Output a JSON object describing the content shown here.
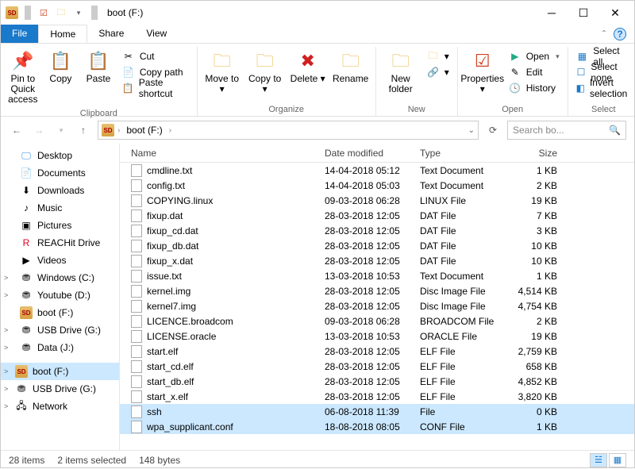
{
  "title": "boot (F:)",
  "tabs": {
    "file": "File",
    "home": "Home",
    "share": "Share",
    "view": "View"
  },
  "ribbon": {
    "clipboard": {
      "label": "Clipboard",
      "pin": "Pin to Quick access",
      "copy": "Copy",
      "paste": "Paste",
      "cut": "Cut",
      "copypath": "Copy path",
      "pasteshortcut": "Paste shortcut"
    },
    "organize": {
      "label": "Organize",
      "moveto": "Move to",
      "copyto": "Copy to",
      "delete": "Delete",
      "rename": "Rename"
    },
    "new": {
      "label": "New",
      "newfolder": "New folder",
      "newitem": "",
      "easyaccess": ""
    },
    "open": {
      "label": "Open",
      "properties": "Properties",
      "open": "Open",
      "edit": "Edit",
      "history": "History"
    },
    "select": {
      "label": "Select",
      "selectall": "Select all",
      "selectnone": "Select none",
      "invert": "Invert selection"
    }
  },
  "address": {
    "crumb1": "boot (F:)",
    "refresh": "⟳",
    "search_placeholder": "Search bo..."
  },
  "nav": [
    {
      "label": "Desktop",
      "ico": "🖵",
      "color": "#3a8ee6"
    },
    {
      "label": "Documents",
      "ico": "📄"
    },
    {
      "label": "Downloads",
      "ico": "⬇"
    },
    {
      "label": "Music",
      "ico": "♪"
    },
    {
      "label": "Pictures",
      "ico": "▣"
    },
    {
      "label": "REACHit Drive",
      "ico": "R",
      "color": "#d02"
    },
    {
      "label": "Videos",
      "ico": "▶"
    },
    {
      "label": "Windows (C:)",
      "ico": "⛃",
      "exp": ">"
    },
    {
      "label": "Youtube (D:)",
      "ico": "⛃",
      "exp": ">"
    },
    {
      "label": "boot (F:)",
      "ico": "SD"
    },
    {
      "label": "USB Drive (G:)",
      "ico": "⛃",
      "exp": ">"
    },
    {
      "label": "Data (J:)",
      "ico": "⛃",
      "exp": ">"
    }
  ],
  "nav2": [
    {
      "label": "boot (F:)",
      "ico": "SD",
      "exp": ">",
      "selected": true
    },
    {
      "label": "USB Drive (G:)",
      "ico": "⛃",
      "exp": ">"
    },
    {
      "label": "Network",
      "ico": "🖧",
      "exp": ">"
    }
  ],
  "cols": {
    "name": "Name",
    "date": "Date modified",
    "type": "Type",
    "size": "Size"
  },
  "files": [
    {
      "name": "cmdline.txt",
      "date": "14-04-2018 05:12",
      "type": "Text Document",
      "size": "1 KB"
    },
    {
      "name": "config.txt",
      "date": "14-04-2018 05:03",
      "type": "Text Document",
      "size": "2 KB"
    },
    {
      "name": "COPYING.linux",
      "date": "09-03-2018 06:28",
      "type": "LINUX File",
      "size": "19 KB"
    },
    {
      "name": "fixup.dat",
      "date": "28-03-2018 12:05",
      "type": "DAT File",
      "size": "7 KB"
    },
    {
      "name": "fixup_cd.dat",
      "date": "28-03-2018 12:05",
      "type": "DAT File",
      "size": "3 KB"
    },
    {
      "name": "fixup_db.dat",
      "date": "28-03-2018 12:05",
      "type": "DAT File",
      "size": "10 KB"
    },
    {
      "name": "fixup_x.dat",
      "date": "28-03-2018 12:05",
      "type": "DAT File",
      "size": "10 KB"
    },
    {
      "name": "issue.txt",
      "date": "13-03-2018 10:53",
      "type": "Text Document",
      "size": "1 KB"
    },
    {
      "name": "kernel.img",
      "date": "28-03-2018 12:05",
      "type": "Disc Image File",
      "size": "4,514 KB"
    },
    {
      "name": "kernel7.img",
      "date": "28-03-2018 12:05",
      "type": "Disc Image File",
      "size": "4,754 KB"
    },
    {
      "name": "LICENCE.broadcom",
      "date": "09-03-2018 06:28",
      "type": "BROADCOM File",
      "size": "2 KB"
    },
    {
      "name": "LICENSE.oracle",
      "date": "13-03-2018 10:53",
      "type": "ORACLE File",
      "size": "19 KB"
    },
    {
      "name": "start.elf",
      "date": "28-03-2018 12:05",
      "type": "ELF File",
      "size": "2,759 KB"
    },
    {
      "name": "start_cd.elf",
      "date": "28-03-2018 12:05",
      "type": "ELF File",
      "size": "658 KB"
    },
    {
      "name": "start_db.elf",
      "date": "28-03-2018 12:05",
      "type": "ELF File",
      "size": "4,852 KB"
    },
    {
      "name": "start_x.elf",
      "date": "28-03-2018 12:05",
      "type": "ELF File",
      "size": "3,820 KB"
    },
    {
      "name": "ssh",
      "date": "06-08-2018 11:39",
      "type": "File",
      "size": "0 KB",
      "selected": true
    },
    {
      "name": "wpa_supplicant.conf",
      "date": "18-08-2018 08:05",
      "type": "CONF File",
      "size": "1 KB",
      "selected": true
    }
  ],
  "status": {
    "items": "28 items",
    "selected": "2 items selected",
    "bytes": "148 bytes"
  }
}
